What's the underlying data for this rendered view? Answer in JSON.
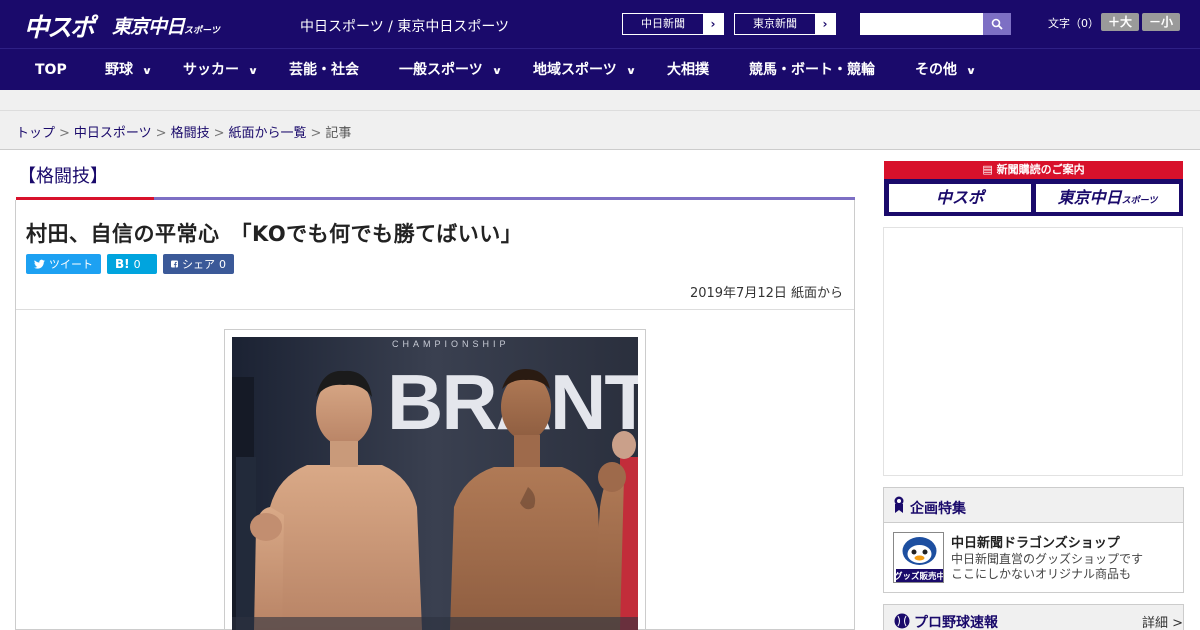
{
  "header": {
    "logo_chunichi": "中スポ",
    "logo_tokyo": "東京中日",
    "logo_tokyo_sub": "スポーツ",
    "site_links": "中日スポーツ / 東京中日スポーツ",
    "paper_buttons": [
      "中日新聞",
      "東京新聞"
    ],
    "fontsize_label": "文字（0）",
    "font_large": "＋大",
    "font_small": "－小"
  },
  "nav": {
    "items": [
      "TOP",
      "野球",
      "サッカー",
      "芸能・社会",
      "一般スポーツ",
      "地域スポーツ",
      "大相撲",
      "競馬・ボート・競輪",
      "その他"
    ]
  },
  "breadcrumb": {
    "items": [
      "トップ",
      "中日スポーツ",
      "格闘技",
      "紙面から一覧"
    ],
    "current": "記事"
  },
  "article": {
    "category": "【格闘技】",
    "headline": "村田、自信の平常心　「KOでも何でも勝てばいい」",
    "tweet_label": "ツイート",
    "hatena_label": "B!",
    "hatena_count": "0",
    "facebook_label": "シェア",
    "facebook_count": "0",
    "date": "2019年7月12日 紙面から",
    "photo_banner_text": "BRANT",
    "photo_small_text": "CHAMPIONSHIP"
  },
  "sidebar": {
    "promo_title": "新聞購読のご案内",
    "promo_buttons": [
      "中スポ",
      "東京中日"
    ],
    "promo_btn2_sub": "スポーツ",
    "feature_title": "企画特集",
    "shop_title": "中日新聞ドラゴンズショップ",
    "shop_desc_1": "中日新聞直営のグッズショップです",
    "shop_desc_2": "ここにしかないオリジナル商品も",
    "shop_thumb_text": "グッズ販売中",
    "baseball_title": "プロ野球速報",
    "baseball_more": "詳細 >"
  },
  "colors": {
    "brand_navy": "#1a0a6b",
    "accent_red": "#d8112b",
    "accent_purple": "#7d6fc4",
    "twitter": "#1da1f2",
    "hatena": "#00a4de",
    "facebook": "#3b5998"
  }
}
